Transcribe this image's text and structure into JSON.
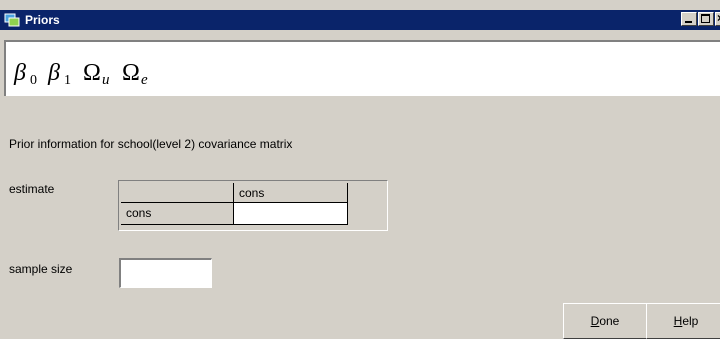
{
  "window": {
    "title": "Priors",
    "title_icon": "app-icon",
    "controls": [
      "minimize-icon",
      "maximize-icon",
      "close-icon"
    ]
  },
  "formula": {
    "beta0": {
      "symbol": "β",
      "sub": "0"
    },
    "beta1": {
      "symbol": "β",
      "sub": "1"
    },
    "omega_u": {
      "symbol": "Ω",
      "sub": "u"
    },
    "omega_e": {
      "symbol": "Ω",
      "sub": "e"
    }
  },
  "prior_info_label": "Prior information for school(level 2) covariance matrix",
  "estimate": {
    "label": "estimate",
    "column_headers": [
      "cons"
    ],
    "rows": [
      {
        "header": "cons",
        "values": [
          ""
        ]
      }
    ]
  },
  "sample_size": {
    "label": "sample size",
    "value": ""
  },
  "buttons": {
    "done": {
      "mnemonic": "D",
      "rest": "one"
    },
    "help": {
      "mnemonic": "H",
      "rest": "elp"
    }
  },
  "colors": {
    "titlebar": "#0a246a",
    "face": "#d4d0c8",
    "panel": "#ffffff"
  }
}
